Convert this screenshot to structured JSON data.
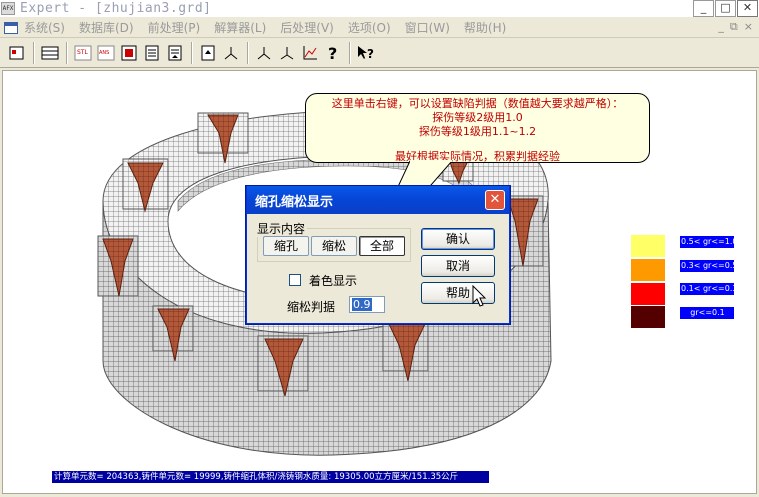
{
  "window": {
    "app_icon_text": "AFX",
    "title": "Expert - [zhujian3.grd]",
    "buttons": [
      "_",
      "□",
      "✕"
    ]
  },
  "menu": {
    "items": [
      "系统(S)",
      "数据库(D)",
      "前处理(P)",
      "解算器(L)",
      "后处理(V)",
      "选项(O)",
      "窗口(W)",
      "帮助(H)"
    ],
    "mdi_buttons": [
      "_",
      "⧉",
      "×"
    ]
  },
  "toolbar": {
    "buttons": [
      {
        "name": "open-icon",
        "glyph": "⎘"
      },
      {
        "name": "grid-icon",
        "glyph": "▦"
      },
      {
        "name": "stl-icon",
        "glyph": "STL"
      },
      {
        "name": "ansys-icon",
        "glyph": "ANS"
      },
      {
        "name": "stop-icon",
        "glyph": "■"
      },
      {
        "name": "list-icon",
        "glyph": "▤"
      },
      {
        "name": "list2-icon",
        "glyph": "▥"
      },
      {
        "name": "result-icon",
        "glyph": "▯"
      },
      {
        "name": "axis-icon",
        "glyph": "⅄"
      },
      {
        "name": "axis2-icon",
        "glyph": "⅄"
      },
      {
        "name": "axis3-icon",
        "glyph": "⅄"
      },
      {
        "name": "chart-icon",
        "glyph": "📈"
      },
      {
        "name": "help-icon",
        "glyph": "?"
      },
      {
        "name": "context-help-icon",
        "glyph": "↖?"
      }
    ]
  },
  "balloon": {
    "lines": [
      "这里单击右键，可以设置缺陷判据（数值越大要求越严格）：",
      "探伤等级2级用1.0",
      "探伤等级1级用1.1~1.2",
      "最好根据实际情况，积累判据经验"
    ]
  },
  "legend": {
    "items": [
      {
        "label": "0.5< gr<=1.0",
        "color": "#ffff66"
      },
      {
        "label": "0.3< gr<=0.5",
        "color": "#ff9900"
      },
      {
        "label": "0.1< gr<=0.3",
        "color": "#ff0000"
      },
      {
        "label": "gr<=0.1",
        "color": "#550000"
      }
    ]
  },
  "status": {
    "text": "计算单元数= 204363,铸件单元数= 19999,铸件缩孔体积/浇铸钢水质量: 19305.00立方厘米/151.35公斤"
  },
  "dialog": {
    "title": "缩孔缩松显示",
    "close": "✕",
    "group_label": "显示内容",
    "segments": [
      "缩孔",
      "缩松",
      "全部"
    ],
    "selected_segment": "全部",
    "checkbox_label": "着色显示",
    "checkbox_checked": false,
    "threshold_label": "缩松判据",
    "threshold_value": "0.9",
    "ok": "确认",
    "cancel": "取消",
    "help": "帮助"
  },
  "colors": {
    "mesh": "#c7c7c7",
    "defect": "#b25a3a"
  }
}
